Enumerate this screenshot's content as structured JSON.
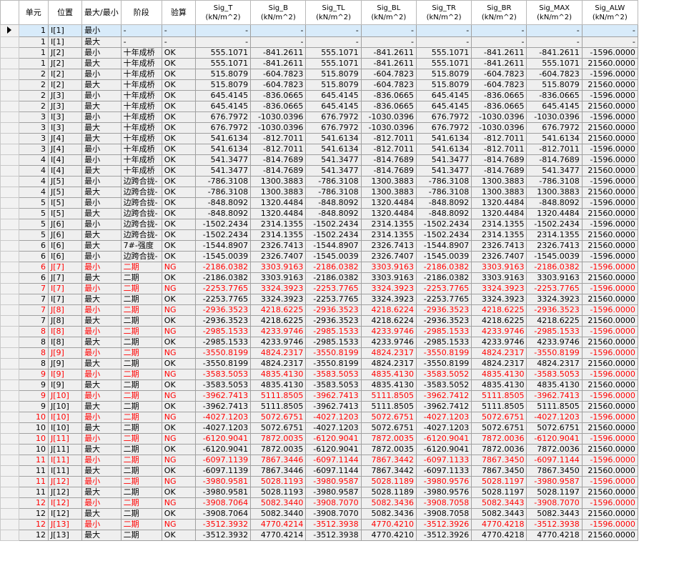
{
  "headers": {
    "unit": "单元",
    "position": "位置",
    "maxmin": "最大/最小",
    "stage": "阶段",
    "check": "验算",
    "sig_t": "Sig_T\n(kN/m^2)",
    "sig_b": "Sig_B\n(kN/m^2)",
    "sig_tl": "Sig_TL\n(kN/m^2)",
    "sig_bl": "Sig_BL\n(kN/m^2)",
    "sig_tr": "Sig_TR\n(kN/m^2)",
    "sig_br": "Sig_BR\n(kN/m^2)",
    "sig_max": "Sig_MAX\n(kN/m^2)",
    "sig_alw": "Sig_ALW\n(kN/m^2)"
  },
  "rows": [
    [
      "1",
      "I[1]",
      "最小",
      "-",
      "-",
      "-",
      "-",
      "-",
      "-",
      "-",
      "-",
      "-",
      "-"
    ],
    [
      "1",
      "I[1]",
      "最大",
      "-",
      "-",
      "-",
      "-",
      "-",
      "-",
      "-",
      "-",
      "-",
      "-"
    ],
    [
      "1",
      "J[2]",
      "最小",
      "十年成桥",
      "OK",
      "555.1071",
      "-841.2611",
      "555.1071",
      "-841.2611",
      "555.1071",
      "-841.2611",
      "-841.2611",
      "-1596.0000"
    ],
    [
      "1",
      "J[2]",
      "最大",
      "十年成桥",
      "OK",
      "555.1071",
      "-841.2611",
      "555.1071",
      "-841.2611",
      "555.1071",
      "-841.2611",
      "555.1071",
      "21560.0000"
    ],
    [
      "2",
      "I[2]",
      "最小",
      "十年成桥",
      "OK",
      "515.8079",
      "-604.7823",
      "515.8079",
      "-604.7823",
      "515.8079",
      "-604.7823",
      "-604.7823",
      "-1596.0000"
    ],
    [
      "2",
      "I[2]",
      "最大",
      "十年成桥",
      "OK",
      "515.8079",
      "-604.7823",
      "515.8079",
      "-604.7823",
      "515.8079",
      "-604.7823",
      "515.8079",
      "21560.0000"
    ],
    [
      "2",
      "J[3]",
      "最小",
      "十年成桥",
      "OK",
      "645.4145",
      "-836.0665",
      "645.4145",
      "-836.0665",
      "645.4145",
      "-836.0665",
      "-836.0665",
      "-1596.0000"
    ],
    [
      "2",
      "J[3]",
      "最大",
      "十年成桥",
      "OK",
      "645.4145",
      "-836.0665",
      "645.4145",
      "-836.0665",
      "645.4145",
      "-836.0665",
      "645.4145",
      "21560.0000"
    ],
    [
      "3",
      "I[3]",
      "最小",
      "十年成桥",
      "OK",
      "676.7972",
      "-1030.0396",
      "676.7972",
      "-1030.0396",
      "676.7972",
      "-1030.0396",
      "-1030.0396",
      "-1596.0000"
    ],
    [
      "3",
      "I[3]",
      "最大",
      "十年成桥",
      "OK",
      "676.7972",
      "-1030.0396",
      "676.7972",
      "-1030.0396",
      "676.7972",
      "-1030.0396",
      "676.7972",
      "21560.0000"
    ],
    [
      "3",
      "J[4]",
      "最大",
      "十年成桥",
      "OK",
      "541.6134",
      "-812.7011",
      "541.6134",
      "-812.7011",
      "541.6134",
      "-812.7011",
      "541.6134",
      "21560.0000"
    ],
    [
      "3",
      "J[4]",
      "最小",
      "十年成桥",
      "OK",
      "541.6134",
      "-812.7011",
      "541.6134",
      "-812.7011",
      "541.6134",
      "-812.7011",
      "-812.7011",
      "-1596.0000"
    ],
    [
      "4",
      "I[4]",
      "最小",
      "十年成桥",
      "OK",
      "541.3477",
      "-814.7689",
      "541.3477",
      "-814.7689",
      "541.3477",
      "-814.7689",
      "-814.7689",
      "-1596.0000"
    ],
    [
      "4",
      "I[4]",
      "最大",
      "十年成桥",
      "OK",
      "541.3477",
      "-814.7689",
      "541.3477",
      "-814.7689",
      "541.3477",
      "-814.7689",
      "541.3477",
      "21560.0000"
    ],
    [
      "4",
      "J[5]",
      "最小",
      "边跨合拢-",
      "OK",
      "-786.3108",
      "1300.3883",
      "-786.3108",
      "1300.3883",
      "-786.3108",
      "1300.3883",
      "-786.3108",
      "-1596.0000"
    ],
    [
      "4",
      "J[5]",
      "最大",
      "边跨合拢-",
      "OK",
      "-786.3108",
      "1300.3883",
      "-786.3108",
      "1300.3883",
      "-786.3108",
      "1300.3883",
      "1300.3883",
      "21560.0000"
    ],
    [
      "5",
      "I[5]",
      "最小",
      "边跨合拢-",
      "OK",
      "-848.8092",
      "1320.4484",
      "-848.8092",
      "1320.4484",
      "-848.8092",
      "1320.4484",
      "-848.8092",
      "-1596.0000"
    ],
    [
      "5",
      "I[5]",
      "最大",
      "边跨合拢-",
      "OK",
      "-848.8092",
      "1320.4484",
      "-848.8092",
      "1320.4484",
      "-848.8092",
      "1320.4484",
      "1320.4484",
      "21560.0000"
    ],
    [
      "5",
      "J[6]",
      "最小",
      "边跨合拢-",
      "OK",
      "-1502.2434",
      "2314.1355",
      "-1502.2434",
      "2314.1355",
      "-1502.2434",
      "2314.1355",
      "-1502.2434",
      "-1596.0000"
    ],
    [
      "5",
      "J[6]",
      "最大",
      "边跨合拢-",
      "OK",
      "-1502.2434",
      "2314.1355",
      "-1502.2434",
      "2314.1355",
      "-1502.2434",
      "2314.1355",
      "2314.1355",
      "21560.0000"
    ],
    [
      "6",
      "I[6]",
      "最大",
      "7#-强度",
      "OK",
      "-1544.8907",
      "2326.7413",
      "-1544.8907",
      "2326.7413",
      "-1544.8907",
      "2326.7413",
      "2326.7413",
      "21560.0000"
    ],
    [
      "6",
      "I[6]",
      "最小",
      "边跨合拢-",
      "OK",
      "-1545.0039",
      "2326.7407",
      "-1545.0039",
      "2326.7407",
      "-1545.0039",
      "2326.7407",
      "-1545.0039",
      "-1596.0000"
    ],
    [
      "6",
      "J[7]",
      "最小",
      "二期",
      "NG",
      "-2186.0382",
      "3303.9163",
      "-2186.0382",
      "3303.9163",
      "-2186.0382",
      "3303.9163",
      "-2186.0382",
      "-1596.0000"
    ],
    [
      "6",
      "J[7]",
      "最大",
      "二期",
      "OK",
      "-2186.0382",
      "3303.9163",
      "-2186.0382",
      "3303.9163",
      "-2186.0382",
      "3303.9163",
      "3303.9163",
      "21560.0000"
    ],
    [
      "7",
      "I[7]",
      "最小",
      "二期",
      "NG",
      "-2253.7765",
      "3324.3923",
      "-2253.7765",
      "3324.3923",
      "-2253.7765",
      "3324.3923",
      "-2253.7765",
      "-1596.0000"
    ],
    [
      "7",
      "I[7]",
      "最大",
      "二期",
      "OK",
      "-2253.7765",
      "3324.3923",
      "-2253.7765",
      "3324.3923",
      "-2253.7765",
      "3324.3923",
      "3324.3923",
      "21560.0000"
    ],
    [
      "7",
      "J[8]",
      "最小",
      "二期",
      "NG",
      "-2936.3523",
      "4218.6225",
      "-2936.3523",
      "4218.6224",
      "-2936.3523",
      "4218.6225",
      "-2936.3523",
      "-1596.0000"
    ],
    [
      "7",
      "J[8]",
      "最大",
      "二期",
      "OK",
      "-2936.3523",
      "4218.6225",
      "-2936.3523",
      "4218.6224",
      "-2936.3523",
      "4218.6225",
      "4218.6225",
      "21560.0000"
    ],
    [
      "8",
      "I[8]",
      "最小",
      "二期",
      "NG",
      "-2985.1533",
      "4233.9746",
      "-2985.1533",
      "4233.9746",
      "-2985.1533",
      "4233.9746",
      "-2985.1533",
      "-1596.0000"
    ],
    [
      "8",
      "I[8]",
      "最大",
      "二期",
      "OK",
      "-2985.1533",
      "4233.9746",
      "-2985.1533",
      "4233.9746",
      "-2985.1533",
      "4233.9746",
      "4233.9746",
      "21560.0000"
    ],
    [
      "8",
      "J[9]",
      "最小",
      "二期",
      "NG",
      "-3550.8199",
      "4824.2317",
      "-3550.8199",
      "4824.2317",
      "-3550.8199",
      "4824.2317",
      "-3550.8199",
      "-1596.0000"
    ],
    [
      "8",
      "J[9]",
      "最大",
      "二期",
      "OK",
      "-3550.8199",
      "4824.2317",
      "-3550.8199",
      "4824.2317",
      "-3550.8199",
      "4824.2317",
      "4824.2317",
      "21560.0000"
    ],
    [
      "9",
      "I[9]",
      "最小",
      "二期",
      "NG",
      "-3583.5053",
      "4835.4130",
      "-3583.5053",
      "4835.4130",
      "-3583.5052",
      "4835.4130",
      "-3583.5053",
      "-1596.0000"
    ],
    [
      "9",
      "I[9]",
      "最大",
      "二期",
      "OK",
      "-3583.5053",
      "4835.4130",
      "-3583.5053",
      "4835.4130",
      "-3583.5052",
      "4835.4130",
      "4835.4130",
      "21560.0000"
    ],
    [
      "9",
      "J[10]",
      "最小",
      "二期",
      "NG",
      "-3962.7413",
      "5111.8505",
      "-3962.7413",
      "5111.8505",
      "-3962.7412",
      "5111.8505",
      "-3962.7413",
      "-1596.0000"
    ],
    [
      "9",
      "J[10]",
      "最大",
      "二期",
      "OK",
      "-3962.7413",
      "5111.8505",
      "-3962.7413",
      "5111.8505",
      "-3962.7412",
      "5111.8505",
      "5111.8505",
      "21560.0000"
    ],
    [
      "10",
      "I[10]",
      "最小",
      "二期",
      "NG",
      "-4027.1203",
      "5072.6751",
      "-4027.1203",
      "5072.6751",
      "-4027.1203",
      "5072.6751",
      "-4027.1203",
      "-1596.0000"
    ],
    [
      "10",
      "I[10]",
      "最大",
      "二期",
      "OK",
      "-4027.1203",
      "5072.6751",
      "-4027.1203",
      "5072.6751",
      "-4027.1203",
      "5072.6751",
      "5072.6751",
      "21560.0000"
    ],
    [
      "10",
      "J[11]",
      "最小",
      "二期",
      "NG",
      "-6120.9041",
      "7872.0035",
      "-6120.9041",
      "7872.0035",
      "-6120.9041",
      "7872.0036",
      "-6120.9041",
      "-1596.0000"
    ],
    [
      "10",
      "J[11]",
      "最大",
      "二期",
      "OK",
      "-6120.9041",
      "7872.0035",
      "-6120.9041",
      "7872.0035",
      "-6120.9041",
      "7872.0036",
      "7872.0036",
      "21560.0000"
    ],
    [
      "11",
      "I[11]",
      "最小",
      "二期",
      "NG",
      "-6097.1139",
      "7867.3446",
      "-6097.1144",
      "7867.3442",
      "-6097.1133",
      "7867.3450",
      "-6097.1144",
      "-1596.0000"
    ],
    [
      "11",
      "I[11]",
      "最大",
      "二期",
      "OK",
      "-6097.1139",
      "7867.3446",
      "-6097.1144",
      "7867.3442",
      "-6097.1133",
      "7867.3450",
      "7867.3450",
      "21560.0000"
    ],
    [
      "11",
      "J[12]",
      "最小",
      "二期",
      "NG",
      "-3980.9581",
      "5028.1193",
      "-3980.9587",
      "5028.1189",
      "-3980.9576",
      "5028.1197",
      "-3980.9587",
      "-1596.0000"
    ],
    [
      "11",
      "J[12]",
      "最大",
      "二期",
      "OK",
      "-3980.9581",
      "5028.1193",
      "-3980.9587",
      "5028.1189",
      "-3980.9576",
      "5028.1197",
      "5028.1197",
      "21560.0000"
    ],
    [
      "12",
      "I[12]",
      "最小",
      "二期",
      "NG",
      "-3908.7064",
      "5082.3440",
      "-3908.7070",
      "5082.3436",
      "-3908.7058",
      "5082.3443",
      "-3908.7070",
      "-1596.0000"
    ],
    [
      "12",
      "I[12]",
      "最大",
      "二期",
      "OK",
      "-3908.7064",
      "5082.3440",
      "-3908.7070",
      "5082.3436",
      "-3908.7058",
      "5082.3443",
      "5082.3443",
      "21560.0000"
    ],
    [
      "12",
      "J[13]",
      "最小",
      "二期",
      "NG",
      "-3512.3932",
      "4770.4214",
      "-3512.3938",
      "4770.4210",
      "-3512.3926",
      "4770.4218",
      "-3512.3938",
      "-1596.0000"
    ],
    [
      "12",
      "J[13]",
      "最大",
      "二期",
      "OK",
      "-3512.3932",
      "4770.4214",
      "-3512.3938",
      "4770.4210",
      "-3512.3926",
      "4770.4218",
      "4770.4218",
      "21560.0000"
    ]
  ],
  "colors": {
    "ng": "#ff0000",
    "selected_row": "#d8ebfa",
    "grid_bg": "#efefef"
  },
  "footer": {
    "text": ""
  }
}
